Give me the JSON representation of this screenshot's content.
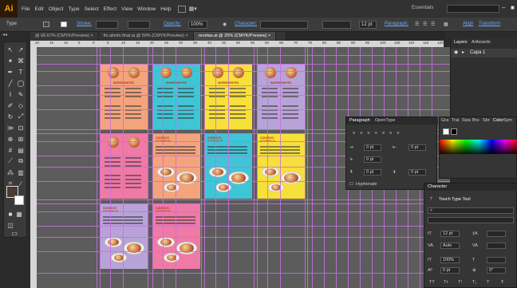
{
  "app": {
    "logo": "Ai"
  },
  "menu": [
    "File",
    "Edit",
    "Object",
    "Type",
    "Select",
    "Effect",
    "View",
    "Window",
    "Help"
  ],
  "workspace": {
    "label": "Essentials",
    "search_placeholder": "",
    "minimize": "–",
    "close": "■"
  },
  "control_bar": {
    "object_type": "Type",
    "stroke_label": "Stroke:",
    "opacity_label": "Opacity:",
    "opacity_value": "100%",
    "character_label": "Character:",
    "font_value": "",
    "font_size": "12 pt",
    "paragraph_label": "Paragraph:",
    "align_label": "Align",
    "transform_label": "Transform"
  },
  "tabs": [
    {
      "label": "@ 66.67% (CMYK/Preview)",
      "active": false
    },
    {
      "label": "fin.alimfo.final.ai @ 50% (CMYK/Preview)",
      "active": false
    },
    {
      "label": "recetas.ai @ 25% (CMYK/Preview)",
      "active": true
    },
    {
      "label": "",
      "active": false
    }
  ],
  "ruler_ticks": [
    "20",
    "15",
    "10",
    "5",
    "0",
    "5",
    "10",
    "15",
    "20",
    "25",
    "30",
    "35",
    "40",
    "45",
    "50",
    "55",
    "60",
    "65",
    "70",
    "75",
    "80",
    "85",
    "90",
    "95",
    "100",
    "105",
    "110",
    "115",
    "120"
  ],
  "artboards": [
    {
      "title": "INGREDIENTES",
      "color": "#f4a47c",
      "type": "recipe"
    },
    {
      "title": "INGREDIENTES",
      "color": "#3ec6d6",
      "type": "recipe"
    },
    {
      "title": "INGREDIENTES",
      "color": "#f8e03a",
      "type": "recipe"
    },
    {
      "title": "INGREDIENTES",
      "color": "#b8a3d8",
      "type": "recipe"
    },
    {
      "title": "",
      "color": "#f07aa6",
      "type": "recipe"
    },
    {
      "title": "CONSEJO ACOMOLIA",
      "color": "#f4a47c",
      "type": "dish"
    },
    {
      "title": "CONSEJO ACOMOLIA",
      "color": "#3ec6d6",
      "type": "dish"
    },
    {
      "title": "CONSEJO ACOMOLIA",
      "color": "#f8e03a",
      "type": "dish"
    },
    {
      "title": "CONSEJO ACOMOLIA",
      "color": "#b8a3d8",
      "type": "dish"
    },
    {
      "title": "CONSEJO ACOMOLIA",
      "color": "#f07aa6",
      "type": "dish"
    }
  ],
  "layers_panel": {
    "tabs": [
      "Layers",
      "Artboards"
    ],
    "layer_name": "Capa 1"
  },
  "paragraph_panel": {
    "tabs": [
      "Paragraph",
      "OpenType"
    ],
    "indent_left": "0 pt",
    "indent_right": "0 pt",
    "first_line": "0 pt",
    "space_before": "0 pt",
    "space_after": "0 pt",
    "hyphenate": "Hyphenate"
  },
  "color_panel": {
    "tabs": [
      "Gra",
      "Trai",
      "Swa",
      "Bru",
      "Sbr",
      "Color",
      "Sym"
    ]
  },
  "character_panel": {
    "title": "Character",
    "touch_type": "Touch Type Tool",
    "font_size": "12 pt",
    "leading": "",
    "kerning": "Auto",
    "tracking": "",
    "v_scale": "100%",
    "h_scale": "",
    "baseline": "0 pt",
    "rotation": "0°",
    "styles": [
      "TT",
      "Tт",
      "T¹",
      "T₁",
      "T",
      "Ŧ"
    ]
  },
  "colors": {
    "ui_bg": "#2b2b2b",
    "canvas": "#5c5c5c",
    "guide": "#c86ee0",
    "accent": "#ff9a00"
  }
}
